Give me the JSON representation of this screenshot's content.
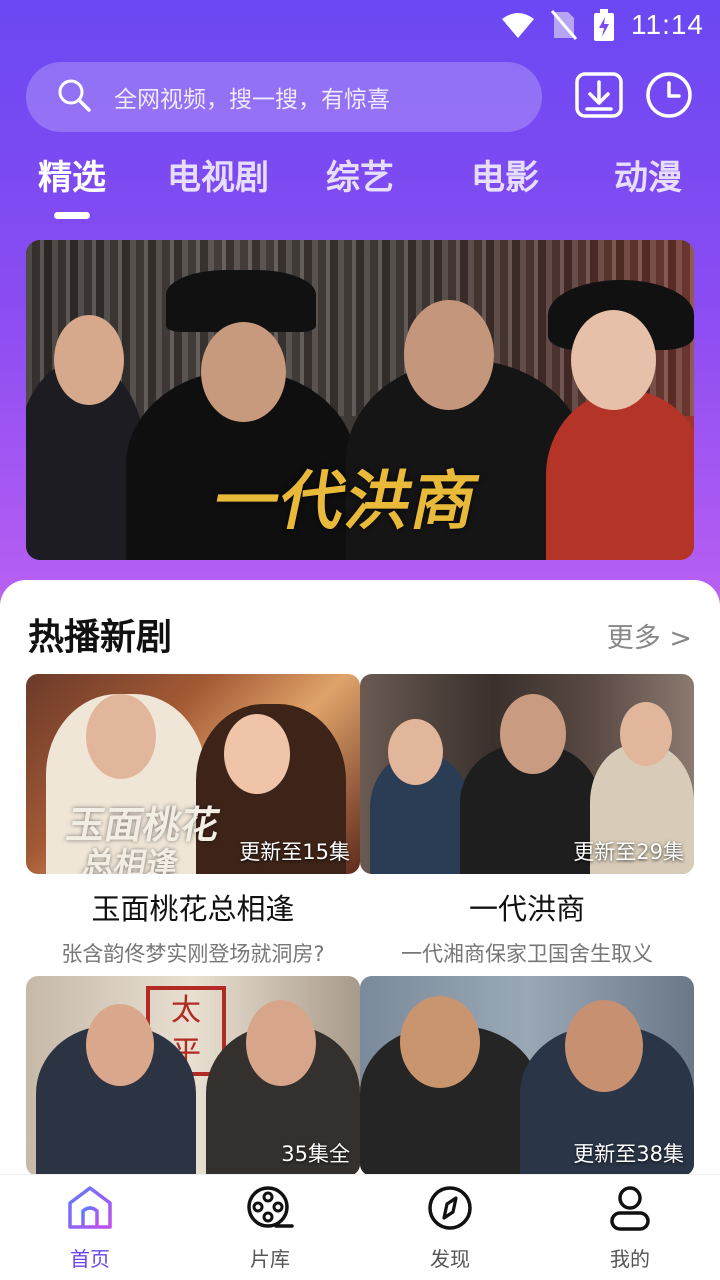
{
  "status_bar": {
    "time": "11:14"
  },
  "search": {
    "placeholder": "全网视频，搜一搜，有惊喜"
  },
  "tabs": [
    {
      "label": "精选",
      "active": true
    },
    {
      "label": "电视剧",
      "active": false
    },
    {
      "label": "综艺",
      "active": false
    },
    {
      "label": "电影",
      "active": false
    },
    {
      "label": "动漫",
      "active": false
    }
  ],
  "banner": {
    "logo_text": "一代洪商"
  },
  "section": {
    "title": "热播新剧",
    "more": "更多 >"
  },
  "cards": [
    {
      "title": "玉面桃花总相逢",
      "subtitle": "张含韵佟梦实刚登场就洞房?",
      "badge": "更新至15集",
      "overlay_text_line1": "玉面桃花",
      "overlay_text_line2": "总相逢"
    },
    {
      "title": "一代洪商",
      "subtitle": "一代湘商保家卫国舍生取义",
      "badge": "更新至29集"
    },
    {
      "title": "",
      "subtitle": "",
      "badge": "35集全",
      "sign_char_1": "太",
      "sign_char_2": "平"
    },
    {
      "title": "",
      "subtitle": "",
      "badge": "更新至38集"
    }
  ],
  "bottom_nav": [
    {
      "label": "首页",
      "icon": "home-icon",
      "active": true
    },
    {
      "label": "片库",
      "icon": "film-reel-icon",
      "active": false
    },
    {
      "label": "发现",
      "icon": "compass-icon",
      "active": false
    },
    {
      "label": "我的",
      "icon": "user-icon",
      "active": false
    }
  ],
  "colors": {
    "accent": "#6b45e8",
    "gradient_top": "#6a48f3",
    "gradient_bottom": "#c06af3"
  }
}
